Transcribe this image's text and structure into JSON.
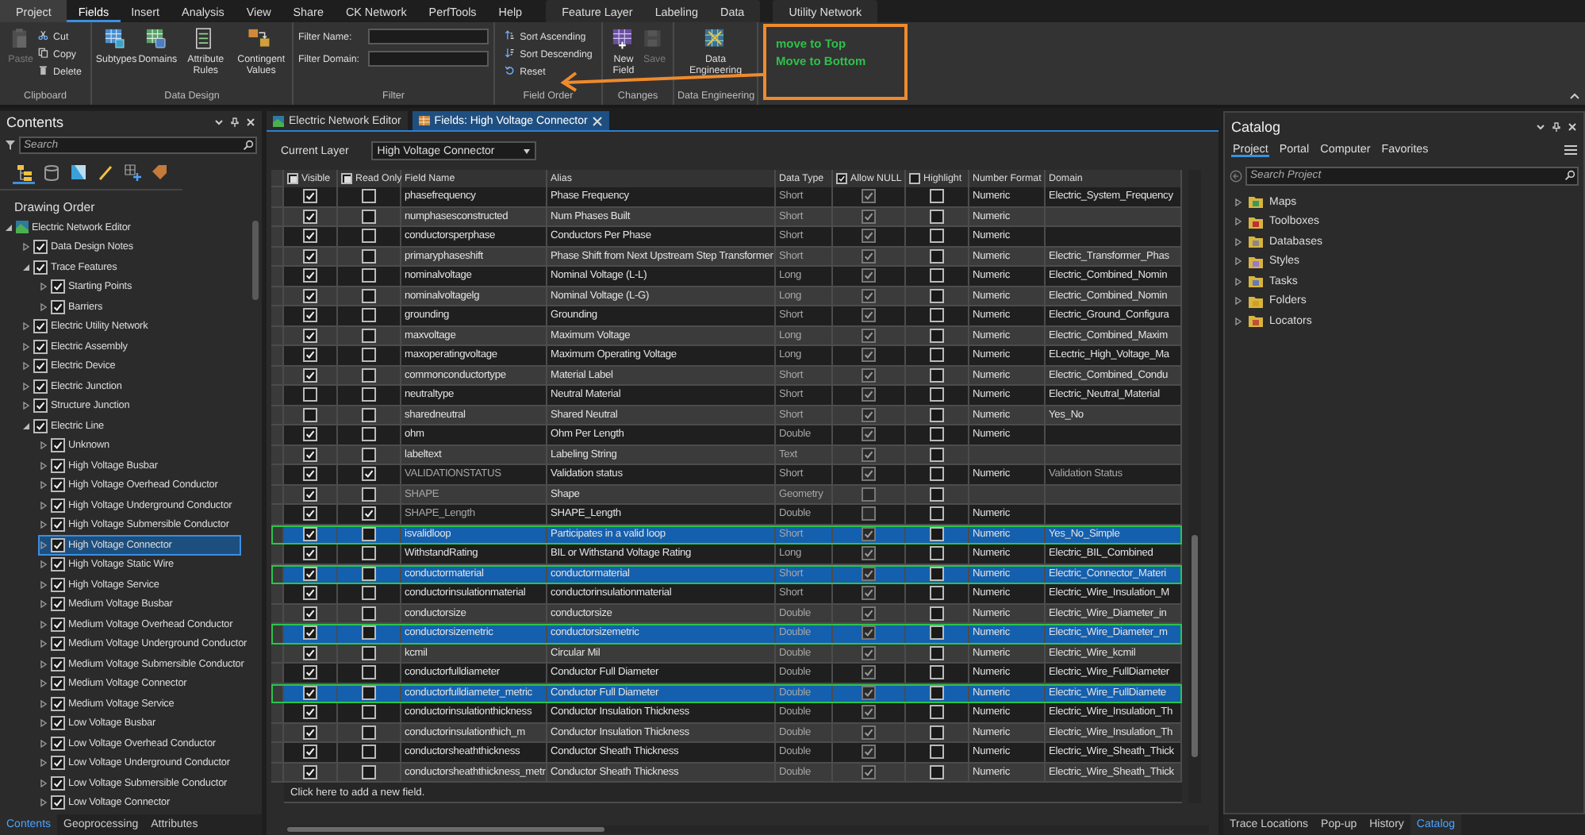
{
  "ribbon": {
    "tab_sets": [
      {
        "kind": "backstage",
        "tabs": [
          {
            "label": "Project",
            "selected": false
          }
        ]
      },
      {
        "kind": "core",
        "tabs": [
          {
            "label": "Fields",
            "selected": true
          },
          {
            "label": "Insert",
            "selected": false
          },
          {
            "label": "Analysis",
            "selected": false
          },
          {
            "label": "View",
            "selected": false
          },
          {
            "label": "Share",
            "selected": false
          },
          {
            "label": "CK Network",
            "selected": false
          },
          {
            "label": "PerfTools",
            "selected": false
          },
          {
            "label": "Help",
            "selected": false
          }
        ]
      },
      {
        "kind": "contextual",
        "tabs": [
          {
            "label": "Feature Layer",
            "selected": false
          },
          {
            "label": "Labeling",
            "selected": false
          },
          {
            "label": "Data",
            "selected": false
          }
        ]
      },
      {
        "kind": "contextual",
        "tabs": [
          {
            "label": "Utility Network",
            "selected": false
          }
        ]
      }
    ],
    "groups": [
      {
        "label": "Clipboard",
        "kind": "mixed",
        "buttons": [
          {
            "label": "Paste",
            "disabled": true
          },
          {
            "label": "Cut",
            "disabled": false
          },
          {
            "label": "Copy",
            "disabled": false
          },
          {
            "label": "Delete",
            "disabled": false
          }
        ]
      },
      {
        "label": "Data Design",
        "kind": "large",
        "buttons": [
          {
            "label": "Subtypes",
            "disabled": false
          },
          {
            "label": "Domains",
            "disabled": false
          },
          {
            "label": "Attribute Rules",
            "disabled": false
          },
          {
            "label": "Contingent Values",
            "disabled": false
          }
        ]
      },
      {
        "label": "Filter",
        "kind": "fields",
        "fields": [
          {
            "label": "Filter Name:"
          },
          {
            "label": "Filter Domain:"
          }
        ]
      },
      {
        "label": "Field Order",
        "kind": "small",
        "buttons": [
          {
            "label": "Sort Ascending",
            "disabled": false
          },
          {
            "label": "Sort Descending",
            "disabled": false
          },
          {
            "label": "Reset",
            "disabled": false
          }
        ]
      },
      {
        "label": "Changes",
        "kind": "large",
        "buttons": [
          {
            "label": "New Field",
            "disabled": false
          },
          {
            "label": "Save",
            "disabled": true
          }
        ]
      },
      {
        "label": "Data Engineering",
        "kind": "large",
        "buttons": [
          {
            "label": "Data Engineering",
            "disabled": false
          }
        ]
      }
    ],
    "annotation": {
      "lines": [
        "move to Top",
        "Move to Bottom"
      ]
    }
  },
  "contents": {
    "title": "Contents",
    "search": {
      "placeholder": "Search"
    },
    "views": [
      {
        "selected": true
      },
      {
        "selected": false
      },
      {
        "selected": false
      },
      {
        "selected": false
      },
      {
        "selected": false
      },
      {
        "selected": false
      }
    ],
    "heading": "Drawing Order",
    "tree": [
      {
        "label": "Electric Network Editor",
        "kind": "map",
        "expanded": true,
        "selected": false,
        "children": [
          {
            "label": "Data Design Notes",
            "kind": "layer",
            "checked": true,
            "expanded": false,
            "selected": false
          },
          {
            "label": "Trace Features",
            "kind": "layer",
            "checked": true,
            "expanded": true,
            "selected": false,
            "children": [
              {
                "label": "Starting Points",
                "kind": "layer",
                "checked": true,
                "expanded": false,
                "selected": false
              },
              {
                "label": "Barriers",
                "kind": "layer",
                "checked": true,
                "expanded": false,
                "selected": false
              }
            ]
          },
          {
            "label": "Electric Utility Network",
            "kind": "layer",
            "checked": true,
            "expanded": false,
            "selected": false
          },
          {
            "label": "Electric Assembly",
            "kind": "layer",
            "checked": true,
            "expanded": false,
            "selected": false
          },
          {
            "label": "Electric Device",
            "kind": "layer",
            "checked": true,
            "expanded": false,
            "selected": false
          },
          {
            "label": "Electric Junction",
            "kind": "layer",
            "checked": true,
            "expanded": false,
            "selected": false
          },
          {
            "label": "Structure Junction",
            "kind": "layer",
            "checked": true,
            "expanded": false,
            "selected": false
          },
          {
            "label": "Electric Line",
            "kind": "layer",
            "checked": true,
            "expanded": true,
            "selected": false,
            "children": [
              {
                "label": "Unknown",
                "kind": "layer",
                "checked": true,
                "expanded": false,
                "selected": false
              },
              {
                "label": "High Voltage Busbar",
                "kind": "layer",
                "checked": true,
                "expanded": false,
                "selected": false
              },
              {
                "label": "High Voltage Overhead Conductor",
                "kind": "layer",
                "checked": true,
                "expanded": false,
                "selected": false
              },
              {
                "label": "High Voltage Underground Conductor",
                "kind": "layer",
                "checked": true,
                "expanded": false,
                "selected": false
              },
              {
                "label": "High Voltage Submersible Conductor",
                "kind": "layer",
                "checked": true,
                "expanded": false,
                "selected": false
              },
              {
                "label": "High Voltage Connector",
                "kind": "layer",
                "checked": true,
                "expanded": false,
                "selected": true
              },
              {
                "label": "High Voltage Static Wire",
                "kind": "layer",
                "checked": true,
                "expanded": false,
                "selected": false
              },
              {
                "label": "High Voltage Service",
                "kind": "layer",
                "checked": true,
                "expanded": false,
                "selected": false
              },
              {
                "label": "Medium Voltage Busbar",
                "kind": "layer",
                "checked": true,
                "expanded": false,
                "selected": false
              },
              {
                "label": "Medium Voltage Overhead Conductor",
                "kind": "layer",
                "checked": true,
                "expanded": false,
                "selected": false
              },
              {
                "label": "Medium Voltage Underground Conductor",
                "kind": "layer",
                "checked": true,
                "expanded": false,
                "selected": false
              },
              {
                "label": "Medium Voltage Submersible Conductor",
                "kind": "layer",
                "checked": true,
                "expanded": false,
                "selected": false
              },
              {
                "label": "Medium Voltage Connector",
                "kind": "layer",
                "checked": true,
                "expanded": false,
                "selected": false
              },
              {
                "label": "Medium Voltage Service",
                "kind": "layer",
                "checked": true,
                "expanded": false,
                "selected": false
              },
              {
                "label": "Low Voltage Busbar",
                "kind": "layer",
                "checked": true,
                "expanded": false,
                "selected": false
              },
              {
                "label": "Low Voltage Overhead Conductor",
                "kind": "layer",
                "checked": true,
                "expanded": false,
                "selected": false
              },
              {
                "label": "Low Voltage Underground Conductor",
                "kind": "layer",
                "checked": true,
                "expanded": false,
                "selected": false
              },
              {
                "label": "Low Voltage Submersible Conductor",
                "kind": "layer",
                "checked": true,
                "expanded": false,
                "selected": false
              },
              {
                "label": "Low Voltage Connector",
                "kind": "layer",
                "checked": true,
                "expanded": false,
                "selected": false
              }
            ]
          }
        ]
      }
    ],
    "tabs": [
      {
        "label": "Contents",
        "selected": true
      },
      {
        "label": "Geoprocessing",
        "selected": false
      },
      {
        "label": "Attributes",
        "selected": false
      }
    ]
  },
  "editor": {
    "doc_tabs": [
      {
        "label": "Electric Network Editor",
        "selected": false
      },
      {
        "label": "Fields: High Voltage Connector",
        "selected": true
      }
    ],
    "current_layer": {
      "label": "Current Layer",
      "value": "High Voltage Connector"
    },
    "table": {
      "columns": [
        {
          "label": "Visible",
          "kind": "checkbox",
          "indeterminate": true
        },
        {
          "label": "Read Only",
          "kind": "checkbox",
          "indeterminate": true
        },
        {
          "label": "Field Name",
          "kind": "text"
        },
        {
          "label": "Alias",
          "kind": "text"
        },
        {
          "label": "Data Type",
          "kind": "text"
        },
        {
          "label": "Allow NULL",
          "kind": "checkbox",
          "checked": true
        },
        {
          "label": "Highlight",
          "kind": "checkbox",
          "checked": false
        },
        {
          "label": "Number Format",
          "kind": "text"
        },
        {
          "label": "Domain",
          "kind": "text"
        }
      ],
      "rows": [
        {
          "visible": true,
          "read_only": false,
          "field_name": "phasefrequency",
          "alias": "Phase Frequency",
          "data_type": "Short",
          "allow_null": true,
          "highlight": false,
          "number_format": "Numeric",
          "domain": "Electric_System_Frequency",
          "locked": false,
          "selected": false
        },
        {
          "visible": true,
          "read_only": false,
          "field_name": "numphasesconstructed",
          "alias": "Num Phases Built",
          "data_type": "Short",
          "allow_null": true,
          "highlight": false,
          "number_format": "Numeric",
          "locked": false,
          "selected": false
        },
        {
          "visible": true,
          "read_only": false,
          "field_name": "conductorsperphase",
          "alias": "Conductors Per Phase",
          "data_type": "Short",
          "allow_null": true,
          "highlight": false,
          "number_format": "Numeric",
          "locked": false,
          "selected": false
        },
        {
          "visible": true,
          "read_only": false,
          "field_name": "primaryphaseshift",
          "alias": "Phase Shift from Next Upstream Step Transformer",
          "data_type": "Short",
          "allow_null": true,
          "highlight": false,
          "number_format": "Numeric",
          "domain": "Electric_Transformer_Phas",
          "locked": false,
          "selected": false
        },
        {
          "visible": true,
          "read_only": false,
          "field_name": "nominalvoltage",
          "alias": "Nominal Voltage (L-L)",
          "data_type": "Long",
          "allow_null": true,
          "highlight": false,
          "number_format": "Numeric",
          "domain": "Electric_Combined_Nomin",
          "locked": false,
          "selected": false
        },
        {
          "visible": true,
          "read_only": false,
          "field_name": "nominalvoltagelg",
          "alias": "Nominal Voltage (L-G)",
          "data_type": "Long",
          "allow_null": true,
          "highlight": false,
          "number_format": "Numeric",
          "domain": "Electric_Combined_Nomin",
          "locked": false,
          "selected": false
        },
        {
          "visible": true,
          "read_only": false,
          "field_name": "grounding",
          "alias": "Grounding",
          "data_type": "Short",
          "allow_null": true,
          "highlight": false,
          "number_format": "Numeric",
          "domain": "Electric_Ground_Configura",
          "locked": false,
          "selected": false
        },
        {
          "visible": true,
          "read_only": false,
          "field_name": "maxvoltage",
          "alias": "Maximum Voltage",
          "data_type": "Long",
          "allow_null": true,
          "highlight": false,
          "number_format": "Numeric",
          "domain": "Electric_Combined_Maxim",
          "locked": false,
          "selected": false
        },
        {
          "visible": true,
          "read_only": false,
          "field_name": "maxoperatingvoltage",
          "alias": "Maximum Operating Voltage",
          "data_type": "Long",
          "allow_null": true,
          "highlight": false,
          "number_format": "Numeric",
          "domain": "ELectric_High_Voltage_Ma",
          "locked": false,
          "selected": false
        },
        {
          "visible": true,
          "read_only": false,
          "field_name": "commonconductortype",
          "alias": "Material Label",
          "data_type": "Short",
          "allow_null": true,
          "highlight": false,
          "number_format": "Numeric",
          "domain": "Electric_Combined_Condu",
          "locked": false,
          "selected": false
        },
        {
          "visible": false,
          "read_only": false,
          "field_name": "neutraltype",
          "alias": "Neutral Material",
          "data_type": "Short",
          "allow_null": true,
          "highlight": false,
          "number_format": "Numeric",
          "domain": "Electric_Neutral_Material",
          "locked": false,
          "selected": false
        },
        {
          "visible": false,
          "read_only": false,
          "field_name": "sharedneutral",
          "alias": "Shared Neutral",
          "data_type": "Short",
          "allow_null": true,
          "highlight": false,
          "number_format": "Numeric",
          "domain": "Yes_No",
          "locked": false,
          "selected": false
        },
        {
          "visible": true,
          "read_only": false,
          "field_name": "ohm",
          "alias": "Ohm Per Length",
          "data_type": "Double",
          "allow_null": true,
          "highlight": false,
          "number_format": "Numeric",
          "locked": false,
          "selected": false
        },
        {
          "visible": true,
          "read_only": false,
          "field_name": "labeltext",
          "alias": "Labeling String",
          "data_type": "Text",
          "allow_null": true,
          "highlight": false,
          "locked": false,
          "selected": false
        },
        {
          "visible": true,
          "read_only": true,
          "field_name": "VALIDATIONSTATUS",
          "alias": "Validation status",
          "data_type": "Short",
          "allow_null": true,
          "highlight": false,
          "number_format": "Numeric",
          "domain": "Validation Status",
          "locked": true,
          "selected": false
        },
        {
          "visible": true,
          "read_only": false,
          "field_name": "SHAPE",
          "alias": "Shape",
          "data_type": "Geometry",
          "allow_null": false,
          "highlight": false,
          "locked": true,
          "selected": false
        },
        {
          "visible": true,
          "read_only": true,
          "field_name": "SHAPE_Length",
          "alias": "SHAPE_Length",
          "data_type": "Double",
          "allow_null": false,
          "highlight": false,
          "number_format": "Numeric",
          "locked": true,
          "selected": false
        },
        {
          "visible": true,
          "read_only": false,
          "field_name": "isvalidloop",
          "alias": "Participates in a valid loop",
          "data_type": "Short",
          "allow_null": true,
          "highlight": false,
          "number_format": "Numeric",
          "domain": "Yes_No_Simple",
          "locked": false,
          "selected": true
        },
        {
          "visible": true,
          "read_only": false,
          "field_name": "WithstandRating",
          "alias": "BIL or Withstand Voltage Rating",
          "data_type": "Long",
          "allow_null": true,
          "highlight": false,
          "number_format": "Numeric",
          "domain": "Electric_BIL_Combined",
          "locked": false,
          "selected": false
        },
        {
          "visible": true,
          "read_only": false,
          "field_name": "conductormaterial",
          "alias": "conductormaterial",
          "data_type": "Short",
          "allow_null": true,
          "highlight": false,
          "number_format": "Numeric",
          "domain": "Electric_Connector_Materi",
          "locked": false,
          "selected": true
        },
        {
          "visible": true,
          "read_only": false,
          "field_name": "conductorinsulationmaterial",
          "alias": "conductorinsulationmaterial",
          "data_type": "Short",
          "allow_null": true,
          "highlight": false,
          "number_format": "Numeric",
          "domain": "Electric_Wire_Insulation_M",
          "locked": false,
          "selected": false
        },
        {
          "visible": true,
          "read_only": false,
          "field_name": "conductorsize",
          "alias": "conductorsize",
          "data_type": "Double",
          "allow_null": true,
          "highlight": false,
          "number_format": "Numeric",
          "domain": "Electric_Wire_Diameter_in",
          "locked": false,
          "selected": false
        },
        {
          "visible": true,
          "read_only": false,
          "field_name": "conductorsizemetric",
          "alias": "conductorsizemetric",
          "data_type": "Double",
          "allow_null": true,
          "highlight": false,
          "number_format": "Numeric",
          "domain": "Electric_Wire_Diameter_m",
          "locked": false,
          "selected": true
        },
        {
          "visible": true,
          "read_only": false,
          "field_name": "kcmil",
          "alias": "Circular Mil",
          "data_type": "Double",
          "allow_null": true,
          "highlight": false,
          "number_format": "Numeric",
          "domain": "Electric_Wire_kcmil",
          "locked": false,
          "selected": false
        },
        {
          "visible": true,
          "read_only": false,
          "field_name": "conductorfulldiameter",
          "alias": "Conductor Full Diameter",
          "data_type": "Double",
          "allow_null": true,
          "highlight": false,
          "number_format": "Numeric",
          "domain": "Electric_Wire_FullDiameter",
          "locked": false,
          "selected": false
        },
        {
          "visible": true,
          "read_only": false,
          "field_name": "conductorfulldiameter_metric",
          "alias": "Conductor Full Diameter",
          "data_type": "Double",
          "allow_null": true,
          "highlight": false,
          "number_format": "Numeric",
          "domain": "Electric_Wire_FullDiamete",
          "locked": false,
          "selected": true
        },
        {
          "visible": true,
          "read_only": false,
          "field_name": "conductorinsulationthickness",
          "alias": "Conductor Insulation Thickness",
          "data_type": "Double",
          "allow_null": true,
          "highlight": false,
          "number_format": "Numeric",
          "domain": "Electric_Wire_Insulation_Th",
          "locked": false,
          "selected": false
        },
        {
          "visible": true,
          "read_only": false,
          "field_name": "conductorinsulationthich_m",
          "alias": "Conductor Insulation Thickness",
          "data_type": "Double",
          "allow_null": true,
          "highlight": false,
          "number_format": "Numeric",
          "domain": "Electric_Wire_Insulation_Th",
          "locked": false,
          "selected": false
        },
        {
          "visible": true,
          "read_only": false,
          "field_name": "conductorsheaththickness",
          "alias": "Conductor Sheath Thickness",
          "data_type": "Double",
          "allow_null": true,
          "highlight": false,
          "number_format": "Numeric",
          "domain": "Electric_Wire_Sheath_Thick",
          "locked": false,
          "selected": false
        },
        {
          "visible": true,
          "read_only": false,
          "field_name": "conductorsheaththickness_metr",
          "alias": "Conductor Sheath Thickness",
          "data_type": "Double",
          "allow_null": true,
          "highlight": false,
          "number_format": "Numeric",
          "domain": "Electric_Wire_Sheath_Thick",
          "locked": false,
          "selected": false
        }
      ],
      "add_row": "Click here to add a new field."
    }
  },
  "catalog": {
    "title": "Catalog",
    "tabs": [
      {
        "label": "Project",
        "selected": true
      },
      {
        "label": "Portal",
        "selected": false
      },
      {
        "label": "Computer",
        "selected": false
      },
      {
        "label": "Favorites",
        "selected": false
      }
    ],
    "search": {
      "placeholder": "Search Project"
    },
    "items": [
      {
        "label": "Maps",
        "expanded": false
      },
      {
        "label": "Toolboxes",
        "expanded": false
      },
      {
        "label": "Databases",
        "expanded": false
      },
      {
        "label": "Styles",
        "expanded": false
      },
      {
        "label": "Tasks",
        "expanded": false
      },
      {
        "label": "Folders",
        "expanded": false
      },
      {
        "label": "Locators",
        "expanded": false
      }
    ],
    "bottom_tabs": [
      {
        "label": "Trace Locations",
        "selected": false
      },
      {
        "label": "Pop-up",
        "selected": false
      },
      {
        "label": "History",
        "selected": false
      },
      {
        "label": "Catalog",
        "selected": true
      }
    ]
  }
}
